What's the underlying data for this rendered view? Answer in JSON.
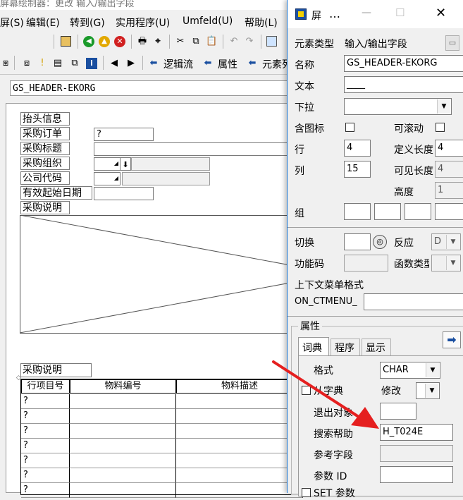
{
  "title_strip": "屏幕绘制器：更改 输入/输出字段",
  "menubar": [
    "屏(S)",
    "编辑(E)",
    "转到(G)",
    "实用程序(U)",
    "Umfeld(U)",
    "帮助(L)"
  ],
  "toolbar2": {
    "logic_flow": "逻辑流",
    "attributes": "属性",
    "element_list": "元素列"
  },
  "element_name_field": "GS_HEADER-EKORG",
  "canvas": {
    "header_group": "抬头信息",
    "fields": [
      {
        "label": "采购订单",
        "value": "?"
      },
      {
        "label": "采购标题",
        "value": ""
      },
      {
        "label": "采购组织",
        "value": ""
      },
      {
        "label": "公司代码",
        "value": ""
      },
      {
        "label": "有效起始日期",
        "value": ""
      },
      {
        "label": "采购说明",
        "value": ""
      }
    ],
    "table_title": "采购说明",
    "table_headers": [
      "行项目号",
      "物料编号",
      "物料描述"
    ],
    "table_rows": [
      "?",
      "?",
      "?",
      "?",
      "?",
      "?",
      "?"
    ]
  },
  "dialog": {
    "title": "屏",
    "element_type_label": "元素类型",
    "element_type_value": "输入/输出字段",
    "name_label": "名称",
    "name_value": "GS_HEADER-EKORG",
    "text_label": "文本",
    "text_value": "____",
    "dropdown_label": "下拉",
    "with_icon_label": "含图标",
    "scrollable_label": "可滚动",
    "row_label": "行",
    "row_value": "4",
    "def_length_label": "定义长度",
    "def_length_value": "4",
    "col_label": "列",
    "col_value": "15",
    "vis_length_label": "可见长度",
    "vis_length_value": "4",
    "height_label": "高度",
    "height_value": "1",
    "group_label": "组",
    "switch_label": "切换",
    "response_label": "反应",
    "response_value": "D",
    "fcode_label": "功能码",
    "functype_label": "函数类型",
    "ctxmenu_section": "上下文菜单格式",
    "ctxmenu_label": "ON_CTMENU_",
    "attributes_group": "属性",
    "tabs": [
      "词典",
      "程序",
      "显示"
    ],
    "format_label": "格式",
    "format_value": "CHAR",
    "from_dict_label": "从字典",
    "modify_label": "修改",
    "exit_obj_label": "退出对象",
    "search_help_label": "搜索帮助",
    "search_help_value": "H_T024E",
    "ref_field_label": "参考字段",
    "param_id_label": "参数 ID",
    "set_param_label": "SET 参数"
  },
  "colors": {
    "annotation_arrow": "#e51f1f",
    "window_border": "#1e78d4"
  }
}
